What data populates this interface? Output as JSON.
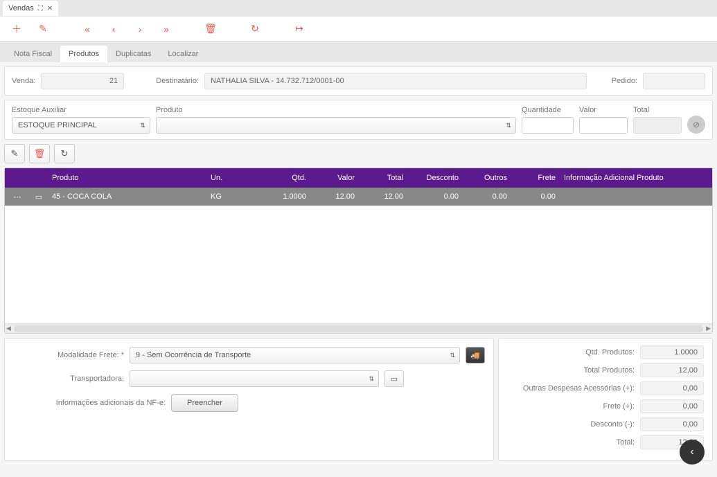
{
  "tab": {
    "title": "Vendas"
  },
  "subtabs": [
    "Nota Fiscal",
    "Produtos",
    "Duplicatas",
    "Localizar"
  ],
  "subtab_active_index": 1,
  "header": {
    "venda_label": "Venda:",
    "venda_value": "21",
    "destinatario_label": "Destinatário:",
    "destinatario_value": "NATHALIA SILVA - 14.732.712/0001-00",
    "pedido_label": "Pedido:",
    "pedido_value": ""
  },
  "entry": {
    "estoque_label": "Estoque Auxiliar",
    "estoque_value": "ESTOQUE PRINCIPAL",
    "produto_label": "Produto",
    "produto_value": "",
    "quantidade_label": "Quantidade",
    "quantidade_value": "",
    "valor_label": "Valor",
    "valor_value": "",
    "total_label": "Total",
    "total_value": ""
  },
  "grid": {
    "headers": {
      "produto": "Produto",
      "un": "Un.",
      "qtd": "Qtd.",
      "valor": "Valor",
      "total": "Total",
      "desconto": "Desconto",
      "outros": "Outros",
      "frete": "Frete",
      "info": "Informação Adicional Produto"
    },
    "rows": [
      {
        "produto": "45 - COCA COLA",
        "un": "KG",
        "qtd": "1.0000",
        "valor": "12.00",
        "total": "12.00",
        "desconto": "0.00",
        "outros": "0.00",
        "frete": "0.00",
        "info": ""
      }
    ]
  },
  "freight": {
    "modalidade_label": "Modalidade Frete: *",
    "modalidade_value": "9 - Sem Ocorrência de Transporte",
    "transportadora_label": "Transportadora:",
    "transportadora_value": "",
    "info_label": "Informações adicionais da NF-e:",
    "preencher_label": "Preencher"
  },
  "summary": {
    "qtd_produtos_label": "Qtd. Produtos:",
    "qtd_produtos_value": "1.0000",
    "total_produtos_label": "Total Produtos:",
    "total_produtos_value": "12,00",
    "outras_label": "Outras Despesas Acessórias (+):",
    "outras_value": "0,00",
    "frete_label": "Frete (+):",
    "frete_value": "0,00",
    "desconto_label": "Desconto (-):",
    "desconto_value": "0,00",
    "total_label": "Total:",
    "total_value": "12,00"
  }
}
